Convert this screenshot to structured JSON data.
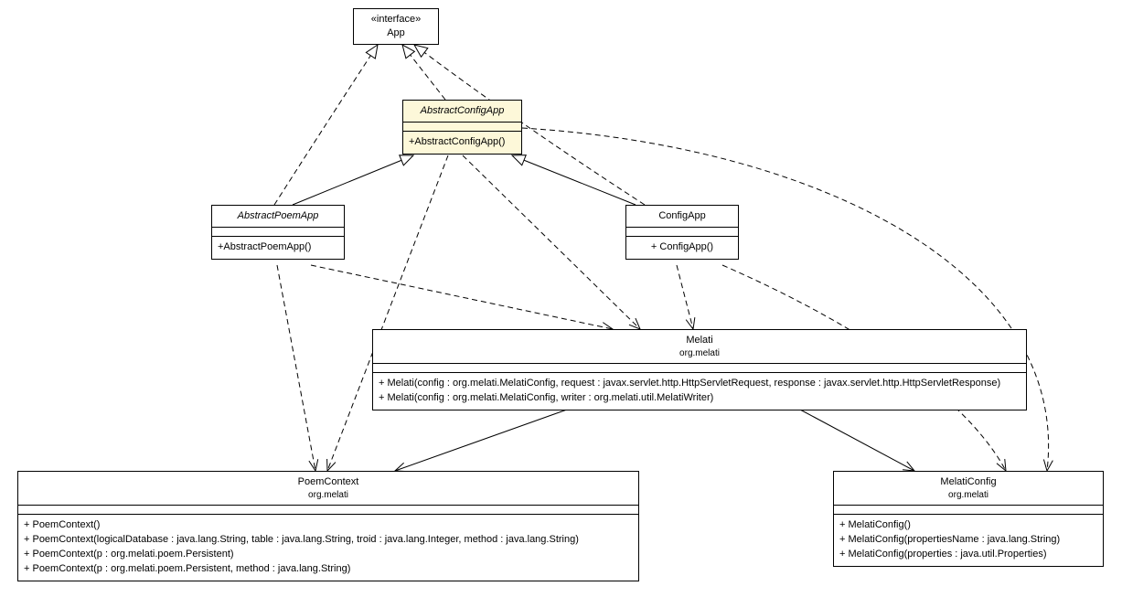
{
  "chart_data": {
    "type": "uml_class_diagram",
    "classes": [
      {
        "id": "App",
        "stereotype": "«interface»",
        "name": "App",
        "package": null,
        "abstract": false,
        "operations": []
      },
      {
        "id": "AbstractConfigApp",
        "stereotype": null,
        "name": "AbstractConfigApp",
        "package": null,
        "abstract": true,
        "operations": [
          "+AbstractConfigApp()"
        ]
      },
      {
        "id": "AbstractPoemApp",
        "stereotype": null,
        "name": "AbstractPoemApp",
        "package": null,
        "abstract": true,
        "operations": [
          "+AbstractPoemApp()"
        ]
      },
      {
        "id": "ConfigApp",
        "stereotype": null,
        "name": "ConfigApp",
        "package": null,
        "abstract": false,
        "operations": [
          "+ ConfigApp()"
        ]
      },
      {
        "id": "Melati",
        "stereotype": null,
        "name": "Melati",
        "package": "org.melati",
        "abstract": false,
        "operations": [
          "+ Melati(config : org.melati.MelatiConfig, request : javax.servlet.http.HttpServletRequest, response : javax.servlet.http.HttpServletResponse)",
          "+ Melati(config : org.melati.MelatiConfig, writer : org.melati.util.MelatiWriter)"
        ]
      },
      {
        "id": "PoemContext",
        "stereotype": null,
        "name": "PoemContext",
        "package": "org.melati",
        "abstract": false,
        "operations": [
          "+ PoemContext()",
          "+ PoemContext(logicalDatabase : java.lang.String, table : java.lang.String, troid : java.lang.Integer, method : java.lang.String)",
          "+ PoemContext(p : org.melati.poem.Persistent)",
          "+ PoemContext(p : org.melati.poem.Persistent, method : java.lang.String)"
        ]
      },
      {
        "id": "MelatiConfig",
        "stereotype": null,
        "name": "MelatiConfig",
        "package": "org.melati",
        "abstract": false,
        "operations": [
          "+ MelatiConfig()",
          "+ MelatiConfig(propertiesName : java.lang.String)",
          "+ MelatiConfig(properties : java.util.Properties)"
        ]
      }
    ],
    "relationships": [
      {
        "from": "AbstractConfigApp",
        "to": "App",
        "type": "realization"
      },
      {
        "from": "AbstractPoemApp",
        "to": "App",
        "type": "realization"
      },
      {
        "from": "ConfigApp",
        "to": "App",
        "type": "realization"
      },
      {
        "from": "AbstractPoemApp",
        "to": "AbstractConfigApp",
        "type": "generalization"
      },
      {
        "from": "ConfigApp",
        "to": "AbstractConfigApp",
        "type": "generalization"
      },
      {
        "from": "AbstractConfigApp",
        "to": "Melati",
        "type": "dependency"
      },
      {
        "from": "AbstractPoemApp",
        "to": "Melati",
        "type": "dependency"
      },
      {
        "from": "ConfigApp",
        "to": "Melati",
        "type": "dependency"
      },
      {
        "from": "AbstractConfigApp",
        "to": "PoemContext",
        "type": "dependency"
      },
      {
        "from": "AbstractPoemApp",
        "to": "PoemContext",
        "type": "dependency"
      },
      {
        "from": "AbstractConfigApp",
        "to": "MelatiConfig",
        "type": "dependency"
      },
      {
        "from": "ConfigApp",
        "to": "MelatiConfig",
        "type": "dependency"
      },
      {
        "from": "Melati",
        "to": "PoemContext",
        "type": "association"
      },
      {
        "from": "Melati",
        "to": "MelatiConfig",
        "type": "association"
      }
    ]
  },
  "boxes": {
    "app": {
      "stereotype": "«interface»",
      "name": "App"
    },
    "abstractconfigapp": {
      "name": "AbstractConfigApp",
      "op0": "+AbstractConfigApp()"
    },
    "abstractpoemapp": {
      "name": "AbstractPoemApp",
      "op0": "+AbstractPoemApp()"
    },
    "configapp": {
      "name": "ConfigApp",
      "op0": "+ ConfigApp()"
    },
    "melati": {
      "name": "Melati",
      "pkg": "org.melati",
      "op0": "+ Melati(config : org.melati.MelatiConfig, request : javax.servlet.http.HttpServletRequest, response : javax.servlet.http.HttpServletResponse)",
      "op1": "+ Melati(config : org.melati.MelatiConfig, writer : org.melati.util.MelatiWriter)"
    },
    "poemcontext": {
      "name": "PoemContext",
      "pkg": "org.melati",
      "op0": "+ PoemContext()",
      "op1": "+ PoemContext(logicalDatabase : java.lang.String, table : java.lang.String, troid : java.lang.Integer, method : java.lang.String)",
      "op2": "+ PoemContext(p : org.melati.poem.Persistent)",
      "op3": "+ PoemContext(p : org.melati.poem.Persistent, method : java.lang.String)"
    },
    "melaticonfig": {
      "name": "MelatiConfig",
      "pkg": "org.melati",
      "op0": "+ MelatiConfig()",
      "op1": "+ MelatiConfig(propertiesName : java.lang.String)",
      "op2": "+ MelatiConfig(properties : java.util.Properties)"
    }
  }
}
